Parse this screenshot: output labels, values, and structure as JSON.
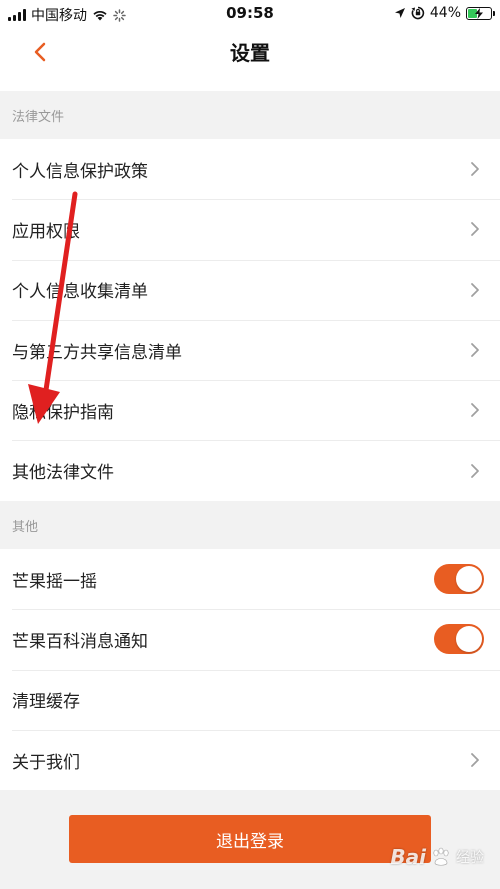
{
  "status_bar": {
    "carrier": "中国移动",
    "time": "09:58",
    "battery_percent": "44%",
    "battery_level": 0.44,
    "icons": [
      "signal-icon",
      "wifi-icon",
      "loading-icon",
      "location-icon",
      "orientation-lock-icon",
      "battery-icon",
      "charging-icon"
    ]
  },
  "header": {
    "title": "设置",
    "back_icon": "chevron-left-icon"
  },
  "sections": [
    {
      "title": "法律文件",
      "items": [
        {
          "label": "个人信息保护政策",
          "control": "chevron"
        },
        {
          "label": "应用权限",
          "control": "chevron"
        },
        {
          "label": "个人信息收集清单",
          "control": "chevron"
        },
        {
          "label": "与第三方共享信息清单",
          "control": "chevron"
        },
        {
          "label": "隐私保护指南",
          "control": "chevron"
        },
        {
          "label": "其他法律文件",
          "control": "chevron"
        }
      ]
    },
    {
      "title": "其他",
      "items": [
        {
          "label": "芒果摇一摇",
          "control": "toggle",
          "on": true
        },
        {
          "label": "芒果百科消息通知",
          "control": "toggle",
          "on": true
        },
        {
          "label": "清理缓存",
          "control": "none"
        },
        {
          "label": "关于我们",
          "control": "chevron"
        }
      ]
    }
  ],
  "logout_label": "退出登录",
  "watermark": {
    "brand": "Bai",
    "paw": "paw-icon",
    "sub": "经验"
  },
  "colors": {
    "accent": "#e85d22",
    "annotation_arrow": "#e02020",
    "background": "#f2f2f2"
  }
}
